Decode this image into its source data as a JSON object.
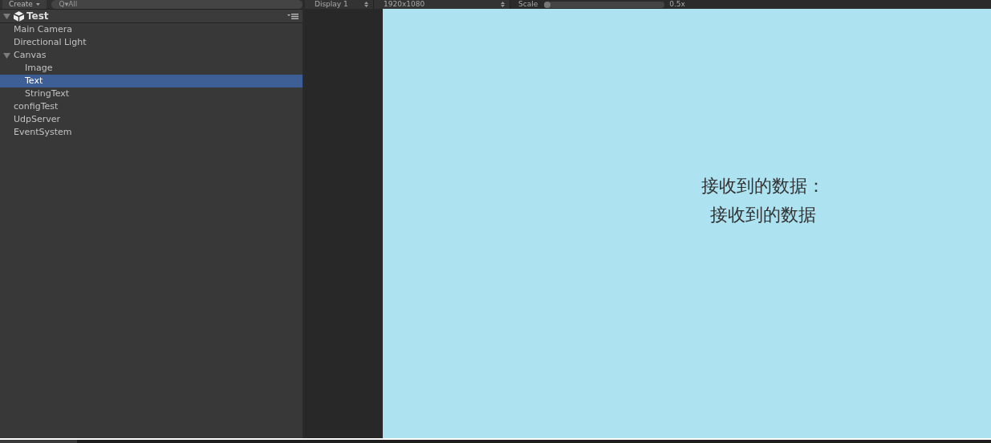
{
  "hierarchy": {
    "create_button": "Create",
    "search": {
      "placeholder": "Q▾All"
    },
    "scene": {
      "title": "Test",
      "expanded": true
    },
    "items": [
      {
        "label": "Main Camera",
        "selected": false
      },
      {
        "label": "Directional Light",
        "selected": false
      },
      {
        "label": "Canvas",
        "selected": false,
        "expanded": true,
        "children": [
          {
            "label": "Image",
            "selected": false
          },
          {
            "label": "Text",
            "selected": true
          },
          {
            "label": "StringText",
            "selected": false
          }
        ]
      },
      {
        "label": "configTest",
        "selected": false
      },
      {
        "label": "UdpServer",
        "selected": false
      },
      {
        "label": "EventSystem",
        "selected": false
      }
    ]
  },
  "game_view": {
    "display": "Display 1",
    "resolution": "1920x1080",
    "scale_label": "Scale",
    "scale": {
      "level": 0.0
    },
    "scale_reading": "0.5x",
    "texts": [
      "接收到的数据：",
      "接收到的数据"
    ]
  }
}
